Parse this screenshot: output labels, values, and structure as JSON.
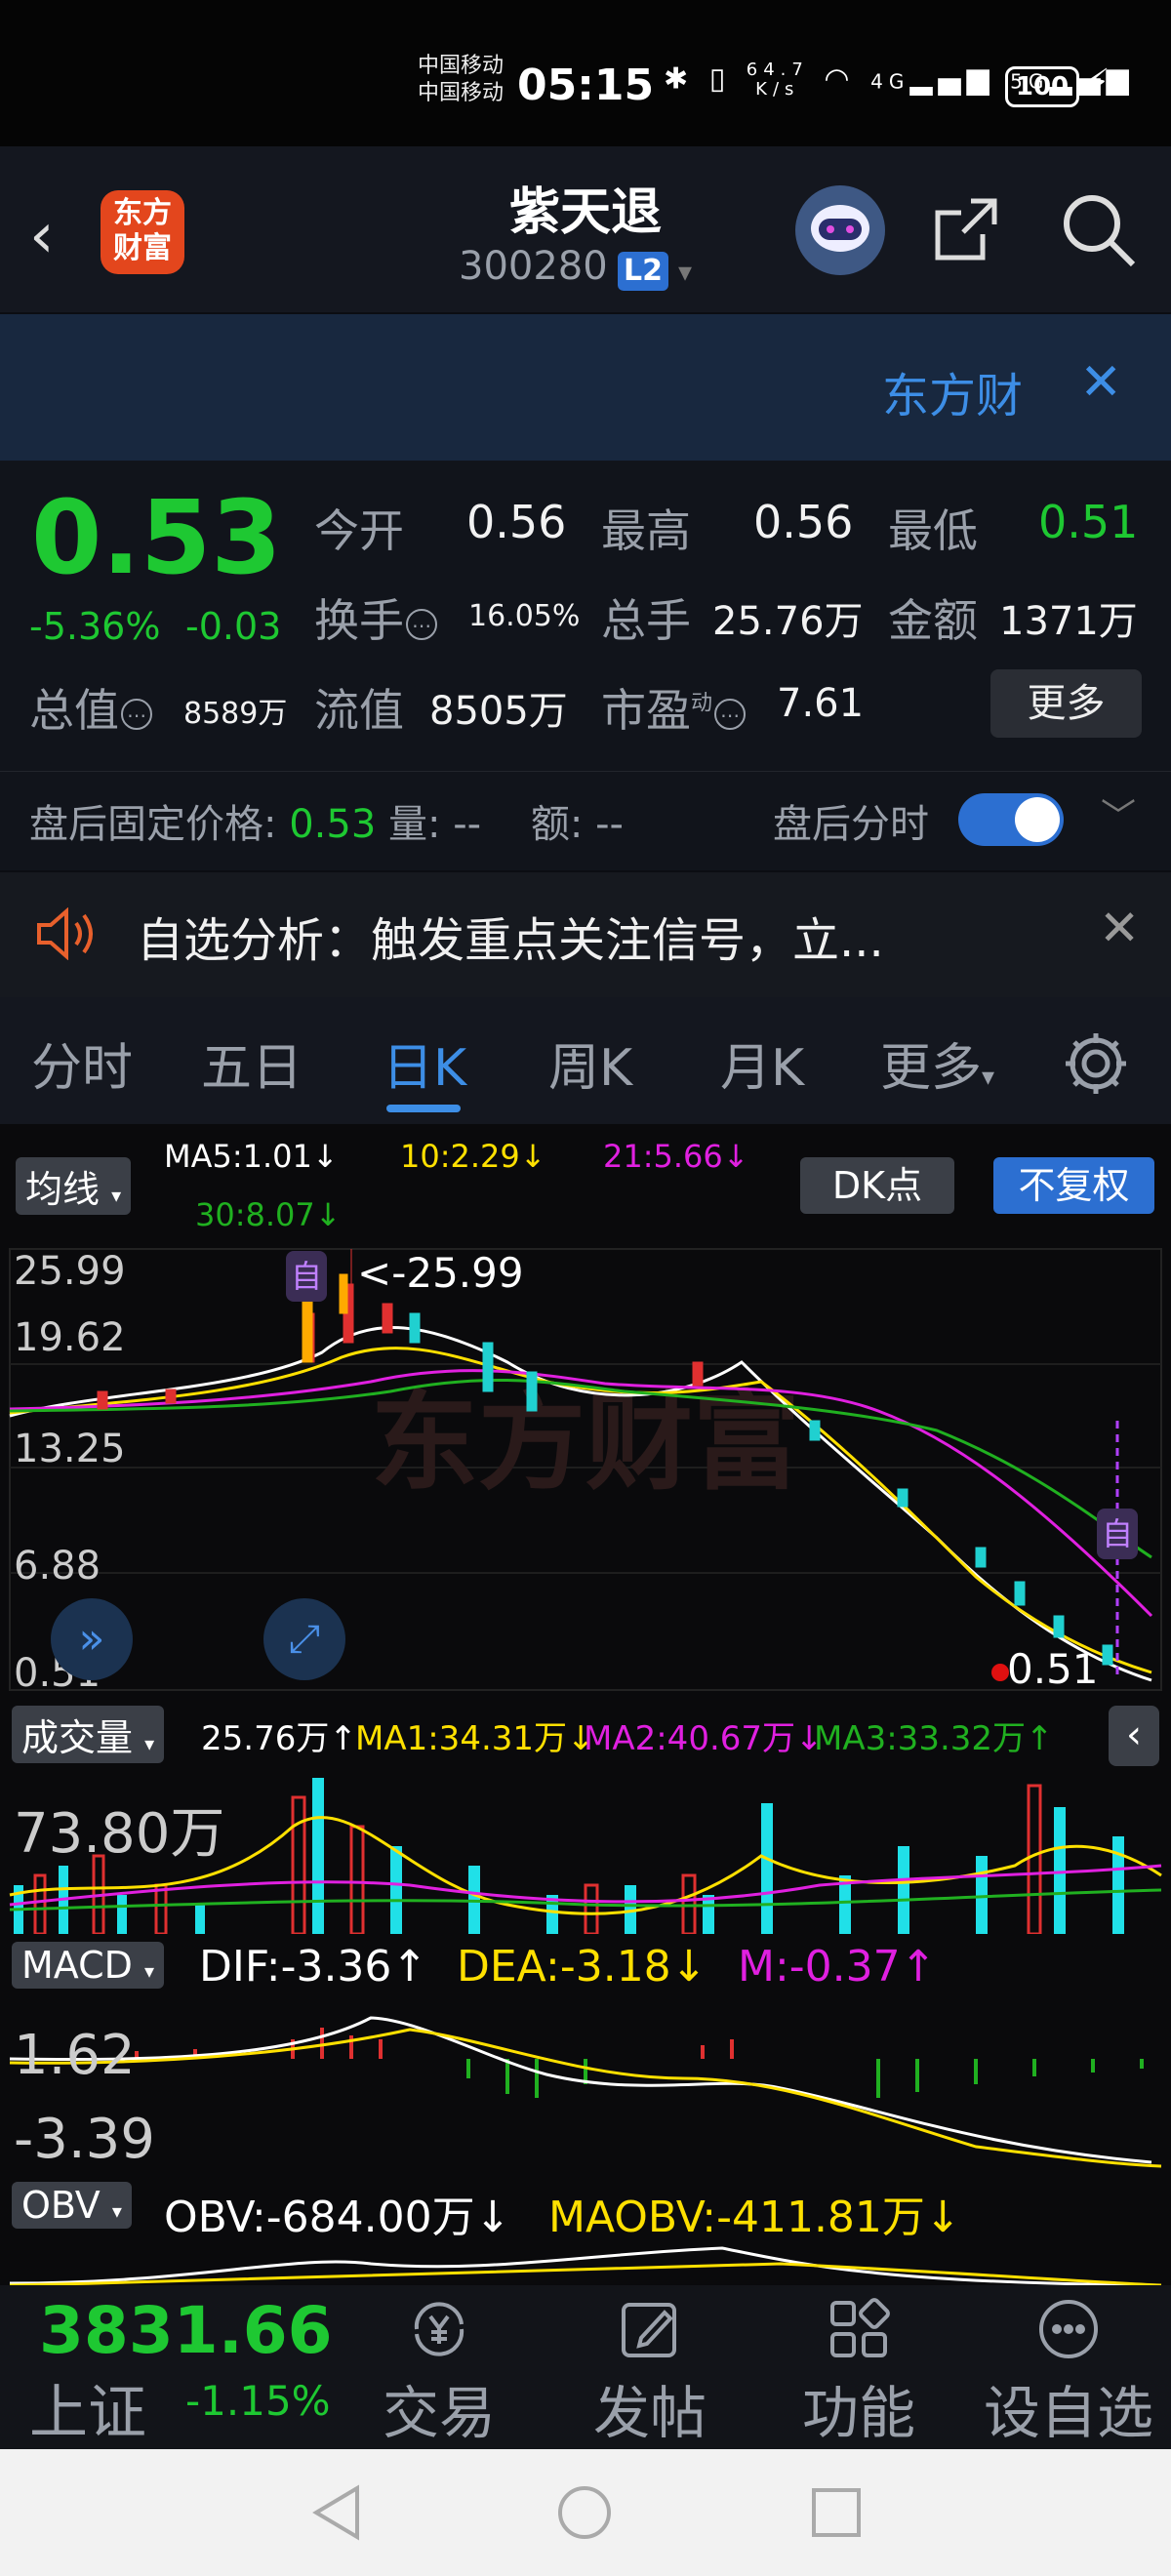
{
  "status_bar": {
    "carrier1": "中国移动",
    "carrier2": "中国移动",
    "time": "05:15",
    "net_speed_top": "64.7",
    "net_speed_bottom": "K/s",
    "net_4g": "4G",
    "net_5g": "5G",
    "battery": "100"
  },
  "header": {
    "logo_text_top": "东方",
    "logo_text_bottom": "财富",
    "stock_name": "紫天退",
    "stock_code": "300280",
    "level_badge": "L2"
  },
  "banner": {
    "text": "东方财",
    "close": "✕"
  },
  "quote": {
    "price": "0.53",
    "change_pct": "-5.36%",
    "change_abs": "-0.03",
    "open_label": "今开",
    "open_value": "0.56",
    "high_label": "最高",
    "high_value": "0.56",
    "low_label": "最低",
    "low_value": "0.51",
    "turnover_label": "换手",
    "turnover_value": "16.05%",
    "volume_label": "总手",
    "volume_value": "25.76万",
    "amount_label": "金额",
    "amount_value": "1371万",
    "total_value_label": "总值",
    "total_value_value": "8589万",
    "float_value_label": "流值",
    "float_value_value": "8505万",
    "pe_label": "市盈",
    "pe_sup": "动",
    "pe_value": "7.61",
    "more_button": "更多",
    "after_hours_label": "盘后固定价格:",
    "after_hours_price": "0.53",
    "after_hours_vol_label": "量:",
    "after_hours_vol": "--",
    "after_hours_amt_label": "额:",
    "after_hours_amt": "--",
    "after_hours_toggle_label": "盘后分时",
    "after_hours_toggle_on": true
  },
  "notice": {
    "text": "自选分析：触发重点关注信号，立...",
    "close": "✕"
  },
  "tabs": [
    {
      "label": "分时",
      "active": false
    },
    {
      "label": "五日",
      "active": false
    },
    {
      "label": "日K",
      "active": true
    },
    {
      "label": "周K",
      "active": false
    },
    {
      "label": "月K",
      "active": false
    },
    {
      "label": "更多",
      "active": false
    }
  ],
  "kline": {
    "ma_button": "均线",
    "ma5": "MA5:1.01↓",
    "ma10": "10:2.29↓",
    "ma21": "21:5.66↓",
    "ma30": "30:8.07↓",
    "dk_button": "DK点",
    "adjust_button": "不复权",
    "y_labels": [
      "25.99",
      "19.62",
      "13.25",
      "6.88",
      "0.51"
    ],
    "high_marker": "<-25.99",
    "low_marker": "0.51",
    "tag_zi": "自",
    "watermark": "东方财富",
    "colors": {
      "ma5": "#ffffff",
      "ma10": "#ffe000",
      "ma21": "#e020e0",
      "ma30": "#20b020"
    }
  },
  "volume": {
    "button": "成交量",
    "value": "25.76万↑",
    "ma1": "MA1:34.31万↓",
    "ma2": "MA2:40.67万↓",
    "ma3": "MA3:33.32万↑",
    "y_label": "73.80万"
  },
  "macd": {
    "button": "MACD",
    "dif": "DIF:-3.36↑",
    "dea": "DEA:-3.18↓",
    "m": "M:-0.37↑",
    "y_top": "1.62",
    "y_bottom": "-3.39"
  },
  "obv": {
    "button": "OBV",
    "obv": "OBV:-684.00万↓",
    "maobv": "MAOBV:-411.81万↓"
  },
  "bottom_nav": {
    "index_value": "3831.66",
    "index_name": "上证",
    "index_change": "-1.15%",
    "items": [
      {
        "label": "交易",
        "icon": "yen-exchange-icon"
      },
      {
        "label": "发帖",
        "icon": "edit-post-icon"
      },
      {
        "label": "功能",
        "icon": "grid-apps-icon"
      },
      {
        "label": "设自选",
        "icon": "more-dots-icon"
      }
    ]
  }
}
